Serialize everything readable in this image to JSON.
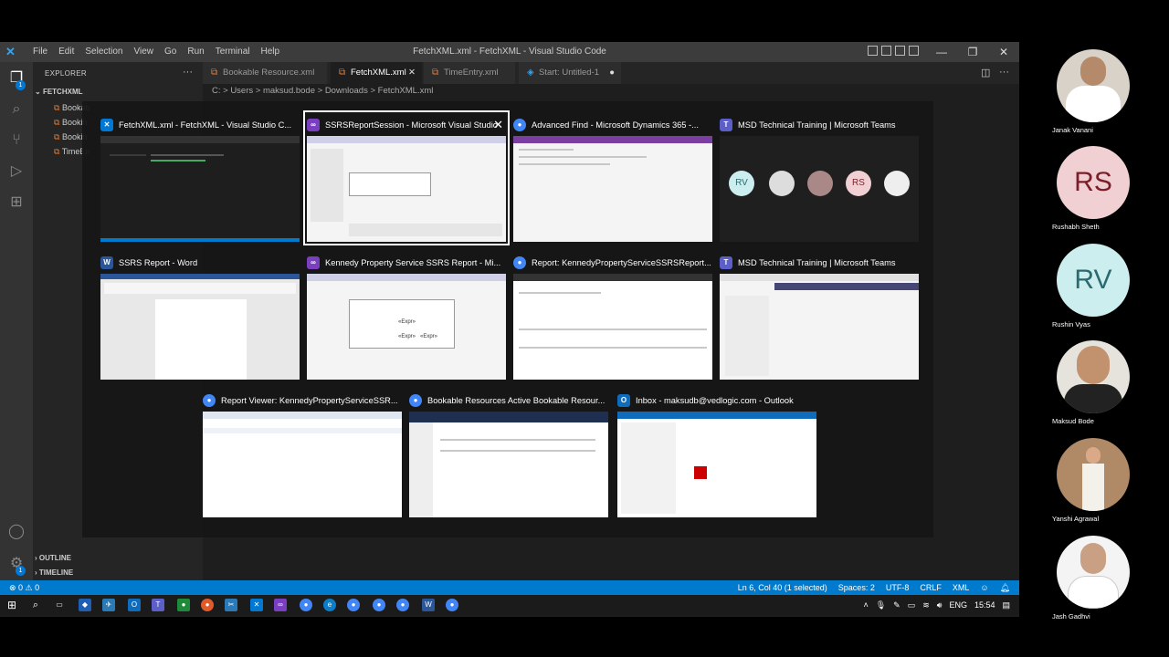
{
  "vscode": {
    "menus": [
      "File",
      "Edit",
      "Selection",
      "View",
      "Go",
      "Run",
      "Terminal",
      "Help"
    ],
    "window_title": "FetchXML.xml - FetchXML - Visual Studio Code",
    "explorer_label": "EXPLORER",
    "folder": "FETCHXML",
    "files": [
      "Bookab",
      "Bookin",
      "Bookin",
      "TimeEn"
    ],
    "outline_label": "OUTLINE",
    "timeline_label": "TIMELINE",
    "tabs": [
      {
        "label": "Bookable Resource.xml",
        "active": false
      },
      {
        "label": "FetchXML.xml",
        "active": true
      },
      {
        "label": "TimeEntry.xml",
        "active": false
      },
      {
        "label": "Start: Untitled-1",
        "active": false
      }
    ],
    "breadcrumb": "C: > Users > maksud.bode > Downloads > FetchXML.xml",
    "status": {
      "problems": "⊗ 0 ⚠ 0",
      "cursor": "Ln 6, Col 40 (1 selected)",
      "spaces": "Spaces: 2",
      "encoding": "UTF-8",
      "eol": "CRLF",
      "language": "XML"
    }
  },
  "taskview": {
    "windows": [
      {
        "title": "FetchXML.xml - FetchXML - Visual Studio C...",
        "icon": "vscode-icon",
        "color": "#0078d4",
        "selected": false
      },
      {
        "title": "SSRSReportSession - Microsoft Visual Studio",
        "icon": "visual-studio-icon",
        "color": "#7a3fc1",
        "selected": true
      },
      {
        "title": "Advanced Find - Microsoft Dynamics 365 -...",
        "icon": "chrome-icon",
        "color": "#4285f4",
        "selected": false
      },
      {
        "title": "MSD Technical Training | Microsoft Teams",
        "icon": "teams-icon",
        "color": "#5b5fc7",
        "selected": false
      },
      {
        "title": "SSRS Report - Word",
        "icon": "word-icon",
        "color": "#2b579a",
        "selected": false
      },
      {
        "title": "Kennedy Property Service SSRS Report - Mi...",
        "icon": "visual-studio-icon",
        "color": "#7a3fc1",
        "selected": false
      },
      {
        "title": "Report: KennedyPropertyServiceSSRSReport...",
        "icon": "chrome-icon",
        "color": "#4285f4",
        "selected": false
      },
      {
        "title": "MSD Technical Training | Microsoft Teams",
        "icon": "teams-icon",
        "color": "#5b5fc7",
        "selected": false
      },
      {
        "title": "Report Viewer: KennedyPropertyServiceSSR...",
        "icon": "chrome-icon",
        "color": "#4285f4",
        "selected": false
      },
      {
        "title": "Bookable Resources Active Bookable Resour...",
        "icon": "chrome-icon",
        "color": "#4285f4",
        "selected": false
      },
      {
        "title": "Inbox - maksudb@vedlogic.com - Outlook",
        "icon": "outlook-icon",
        "color": "#0f6cbd",
        "selected": false
      }
    ],
    "teams_initials": [
      "RV",
      "RS"
    ],
    "report_expr": "«Expr»"
  },
  "participants": [
    {
      "name": "Janak Vanani",
      "initials": "",
      "bg": "#d9d2c8",
      "fg": "#333"
    },
    {
      "name": "Rushabh Sheth",
      "initials": "RS",
      "bg": "#f0d0d2",
      "fg": "#7a1f2a"
    },
    {
      "name": "Rushin Vyas",
      "initials": "RV",
      "bg": "#cdeeee",
      "fg": "#2a6a70"
    },
    {
      "name": "Maksud Bode",
      "initials": "",
      "bg": "#e6e2dc",
      "fg": "#333"
    },
    {
      "name": "Yanshi Agrawal",
      "initials": "",
      "bg": "#b08a66",
      "fg": "#333"
    },
    {
      "name": "Jash Gadhvi",
      "initials": "",
      "bg": "#f4f4f4",
      "fg": "#333"
    }
  ],
  "taskbar": {
    "lang": "ENG",
    "time": "15:54"
  }
}
